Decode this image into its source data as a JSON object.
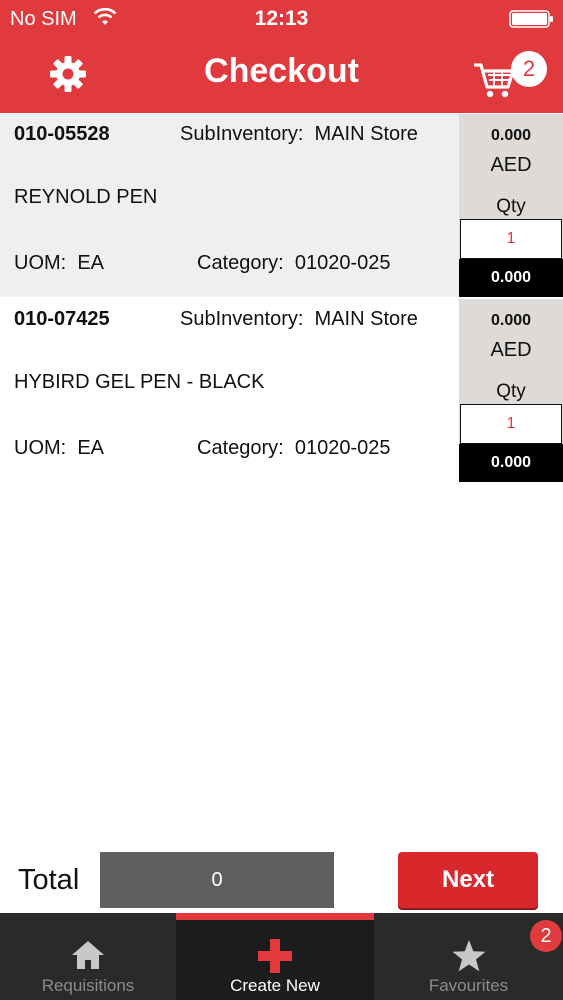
{
  "status_bar": {
    "carrier": "No SIM",
    "time": "12:13"
  },
  "header": {
    "title": "Checkout",
    "cart_count": "2"
  },
  "items": [
    {
      "code": "010-05528",
      "subinventory_label": "SubInventory:",
      "subinventory": "MAIN Store",
      "name": "REYNOLD PEN",
      "uom_label": "UOM:",
      "uom": "EA",
      "category_label": "Category:",
      "category": "01020-025",
      "unit_price": "0.000",
      "currency": "AED",
      "qty_label": "Qty",
      "qty": "1",
      "line_total": "0.000"
    },
    {
      "code": "010-07425",
      "subinventory_label": "SubInventory:",
      "subinventory": "MAIN Store",
      "name": "HYBIRD GEL PEN - BLACK",
      "uom_label": "UOM:",
      "uom": "EA",
      "category_label": "Category:",
      "category": "01020-025",
      "unit_price": "0.000",
      "currency": "AED",
      "qty_label": "Qty",
      "qty": "1",
      "line_total": "0.000"
    }
  ],
  "footer": {
    "total_label": "Total",
    "total_value": "0",
    "next_label": "Next"
  },
  "tabs": [
    {
      "label": "Requisitions",
      "icon": "home-icon",
      "active": false
    },
    {
      "label": "Create New",
      "icon": "plus-icon",
      "active": true
    },
    {
      "label": "Favourites",
      "icon": "star-icon",
      "active": false,
      "badge": "2"
    }
  ],
  "colors": {
    "accent": "#e03a3e",
    "tabbar": "#2a2a2a",
    "price_panel": "#dddad7",
    "total_box": "#5e5e5e"
  }
}
